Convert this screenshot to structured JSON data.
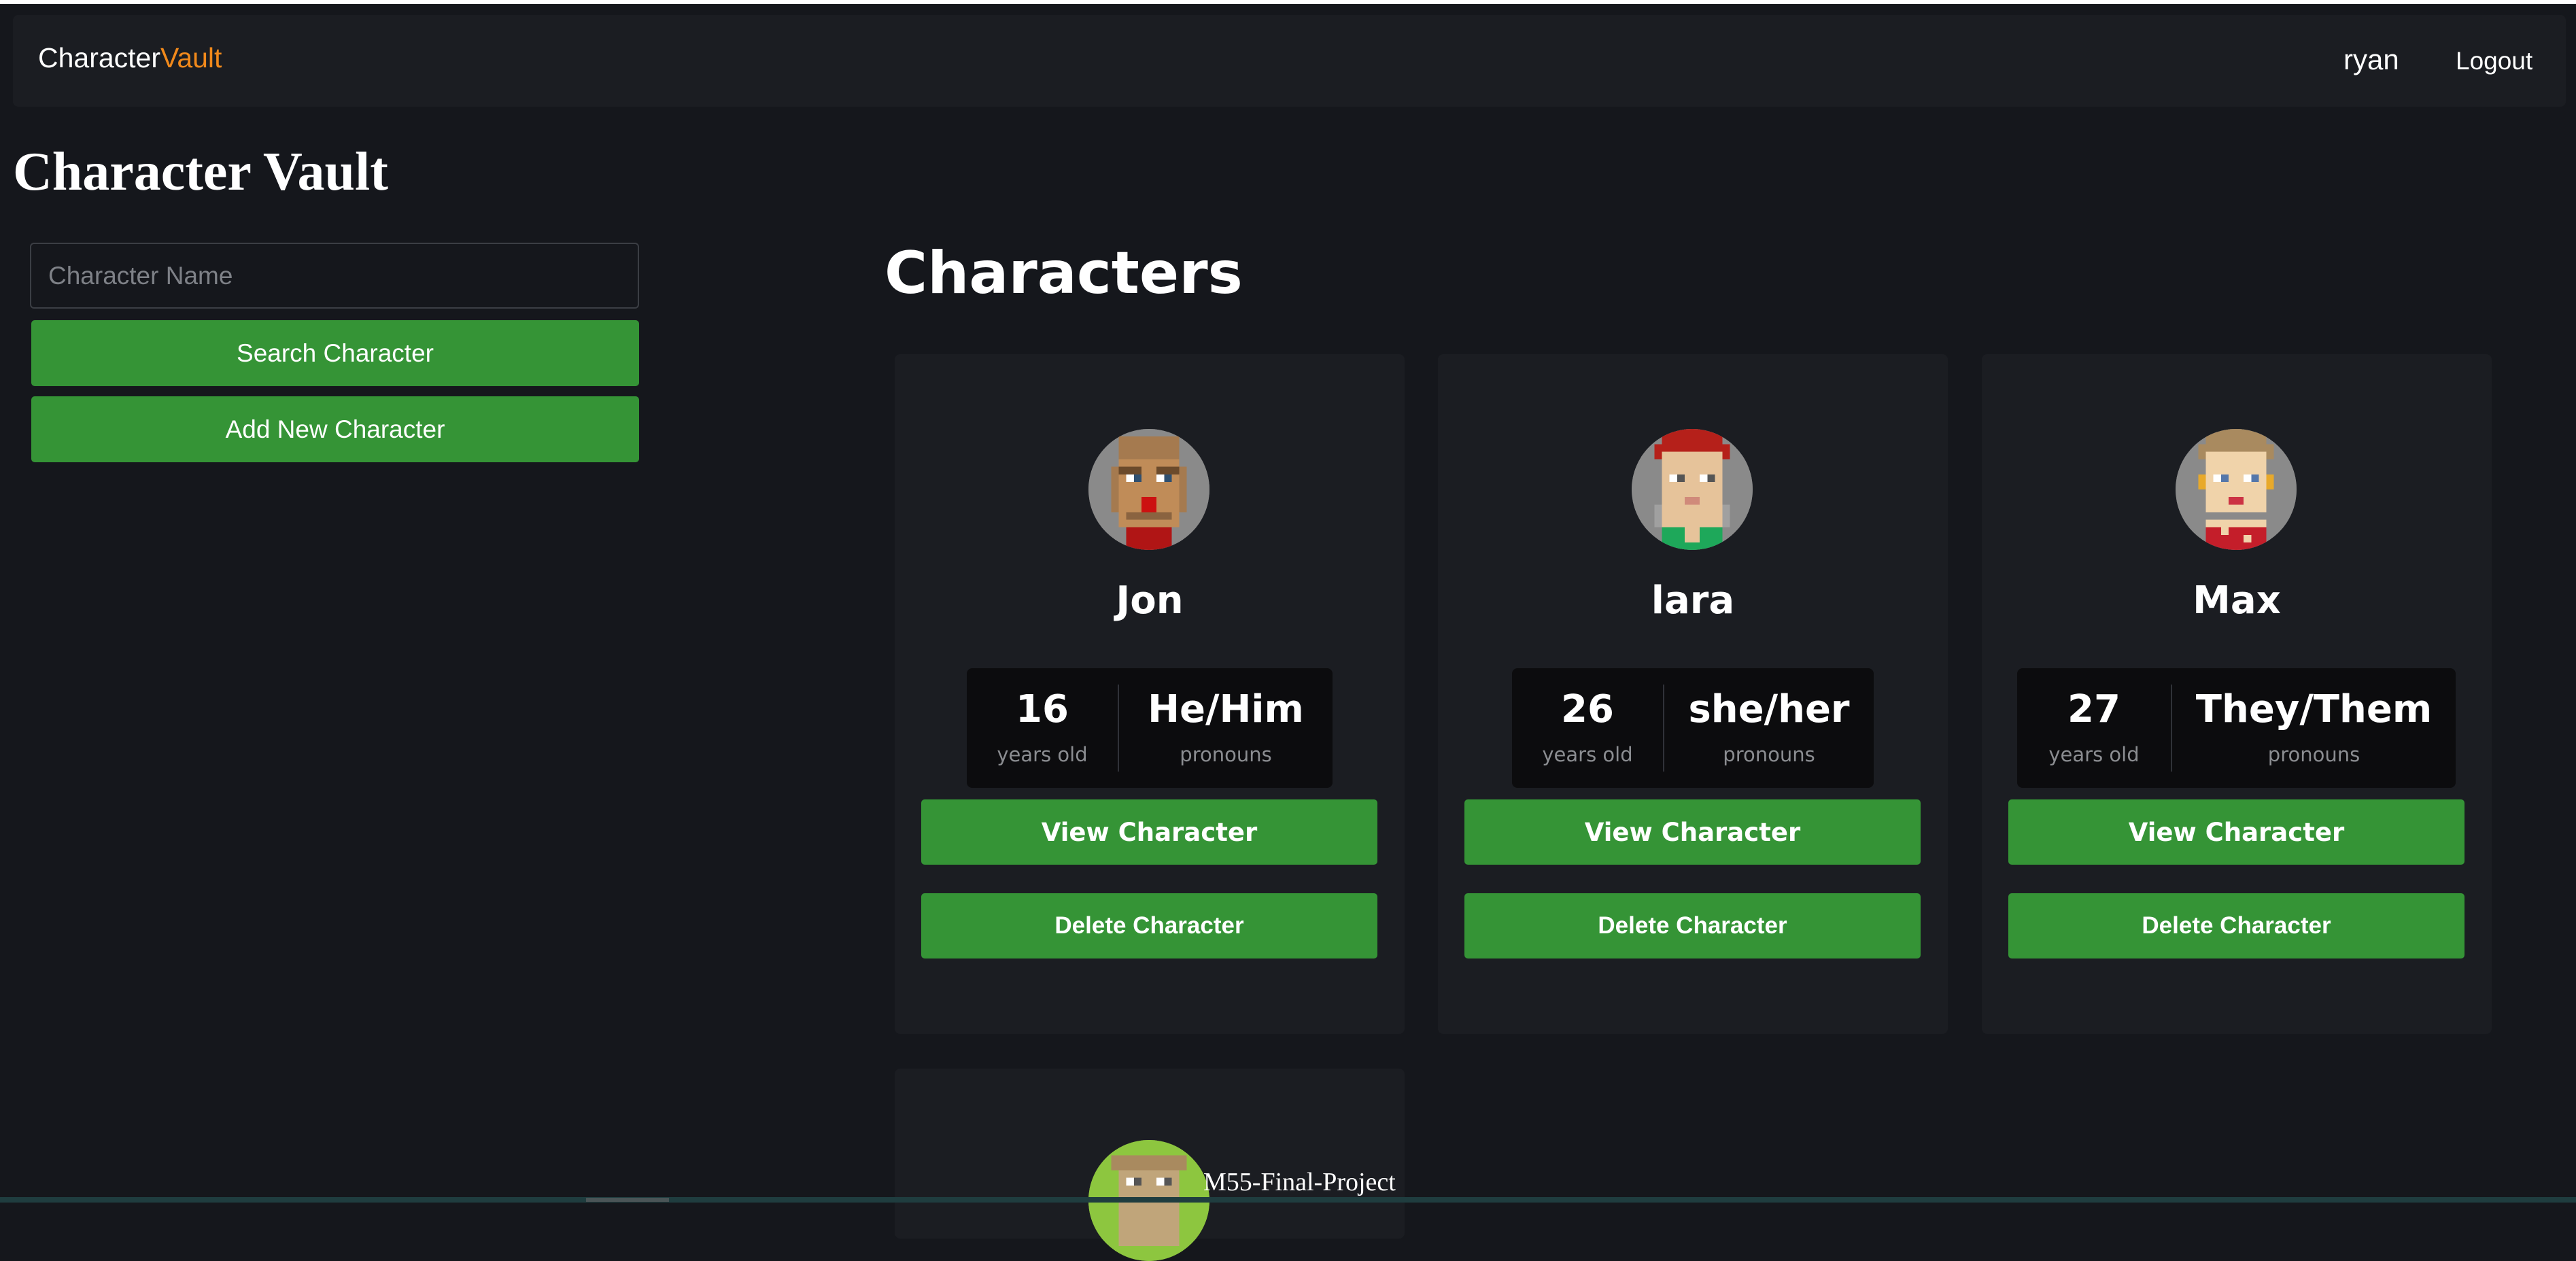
{
  "navbar": {
    "brand_part1": "Character",
    "brand_part2": "Vault",
    "user": "ryan",
    "logout_label": "Logout"
  },
  "page_title": "Character Vault",
  "sidebar": {
    "search_placeholder": "Character Name",
    "search_value": "",
    "search_button": "Search Character",
    "add_button": "Add New Character"
  },
  "main": {
    "section_title": "Characters",
    "cards": [
      {
        "name": "Jon",
        "age": "16",
        "age_label": "years old",
        "pronouns": "He/Him",
        "pronouns_label": "pronouns",
        "view_label": "View Character",
        "delete_label": "Delete Character",
        "avatar_icon": "pixel-avatar-jon"
      },
      {
        "name": "lara",
        "age": "26",
        "age_label": "years old",
        "pronouns": "she/her",
        "pronouns_label": "pronouns",
        "view_label": "View Character",
        "delete_label": "Delete Character",
        "avatar_icon": "pixel-avatar-lara"
      },
      {
        "name": "Max",
        "age": "27",
        "age_label": "years old",
        "pronouns": "They/Them",
        "pronouns_label": "pronouns",
        "view_label": "View Character",
        "delete_label": "Delete Character",
        "avatar_icon": "pixel-avatar-max"
      }
    ]
  },
  "footer_text": "M55-Final-Project",
  "colors": {
    "background": "#15171c",
    "card": "#1b1d22",
    "accent_green": "#359436",
    "brand_orange": "#f1891b"
  }
}
